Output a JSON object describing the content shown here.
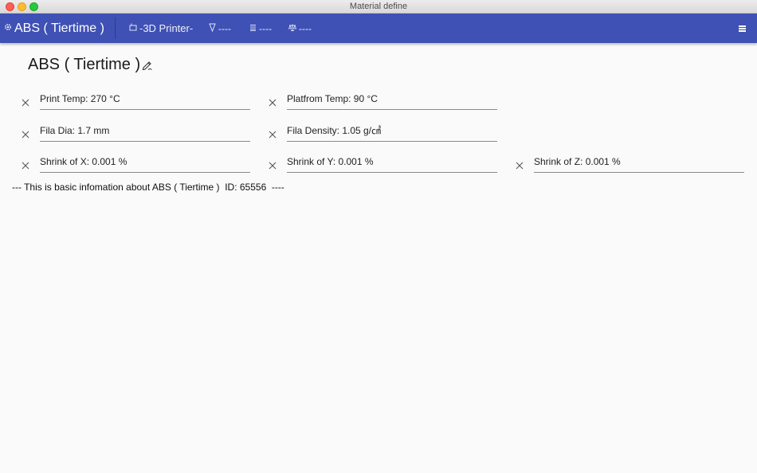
{
  "window": {
    "title": "Material define"
  },
  "toolbar": {
    "app_label": "ABS ( Tiertime )",
    "printer_label": "-3D Printer-",
    "nozzle_label": "----",
    "list_label": "----",
    "scale_label": "----",
    "icons": {
      "app": "gear-icon",
      "printer": "printer-icon",
      "nozzle": "nozzle-icon",
      "list": "list-icon",
      "scale": "scale-icon",
      "menu": "hamburger-menu-icon"
    }
  },
  "material": {
    "title": "ABS ( Tiertime )",
    "fields": {
      "print_temp": "Print Temp: 270 °C",
      "platform_temp": "Platfrom Temp: 90 °C",
      "fila_dia": "Fila Dia: 1.7 mm",
      "fila_density": "Fila Density: 1.05 g/㎤",
      "shrink_x": "Shrink of X: 0.001 %",
      "shrink_y": "Shrink of Y: 0.001 %",
      "shrink_z": "Shrink of Z: 0.001 %"
    },
    "info": "--- This is basic infomation about ABS ( Tiertime )  ID: 65556  ----"
  },
  "colors": {
    "toolbar_bg": "#3f51b5",
    "background": "#fafafa",
    "underline": "#8a8a8a"
  }
}
